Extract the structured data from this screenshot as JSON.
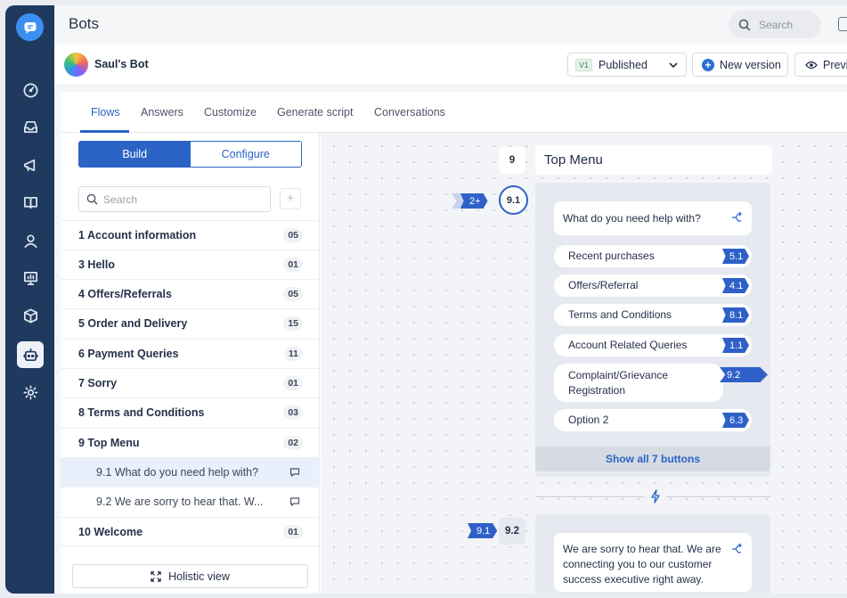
{
  "app": {
    "page_title": "Bots",
    "search_placeholder": "Search"
  },
  "bot": {
    "name": "Saul's Bot",
    "version_badge": "V1",
    "status": "Published",
    "new_version_label": "New version",
    "preview_label": "Previ"
  },
  "tabs": [
    {
      "label": "Flows",
      "active": true
    },
    {
      "label": "Answers"
    },
    {
      "label": "Customize"
    },
    {
      "label": "Generate script"
    },
    {
      "label": "Conversations"
    }
  ],
  "left": {
    "build_label": "Build",
    "configure_label": "Configure",
    "search_placeholder": "Search",
    "add_label": "+",
    "flows": [
      {
        "title": "1   Account information",
        "count": "05"
      },
      {
        "title": "3   Hello",
        "count": "01"
      },
      {
        "title": "4   Offers/Referrals",
        "count": "05"
      },
      {
        "title": "5   Order and Delivery",
        "count": "15"
      },
      {
        "title": "6   Payment Queries",
        "count": "11"
      },
      {
        "title": "7   Sorry",
        "count": "01"
      },
      {
        "title": "8   Terms and Conditions",
        "count": "03"
      },
      {
        "title": "9   Top Menu",
        "count": "02"
      },
      {
        "title": "9.1   What do you need help with?",
        "sub": true,
        "highlighted": true
      },
      {
        "title": "9.2   We are sorry to hear that. W...",
        "sub": true
      },
      {
        "title": "10   Welcome",
        "count": "01"
      }
    ],
    "holistic_label": "Holistic view"
  },
  "canvas": {
    "flow_number": "9",
    "flow_title": "Top Menu",
    "incoming_count": "2+",
    "node1_id": "9.1",
    "question": "What do you need help with?",
    "options": [
      {
        "label": "Recent purchases",
        "target": "5.1"
      },
      {
        "label": "Offers/Referral",
        "target": "4.1"
      },
      {
        "label": "Terms and Conditions",
        "target": "8.1"
      },
      {
        "label": "Account Related Queries",
        "target": "1.1"
      },
      {
        "label": "Complaint/Grievance Registration",
        "target": "9.2"
      },
      {
        "label": "Option 2",
        "target": "6.3"
      }
    ],
    "show_all_label": "Show all 7 buttons",
    "node2_incoming": "9.1",
    "node2_id": "9.2",
    "message": "We are sorry to hear that. We are connecting you to our customer success executive right away."
  },
  "colors": {
    "rail": "#1f3a5e",
    "accent": "#2b63c6",
    "tag": "#2e60c8"
  }
}
